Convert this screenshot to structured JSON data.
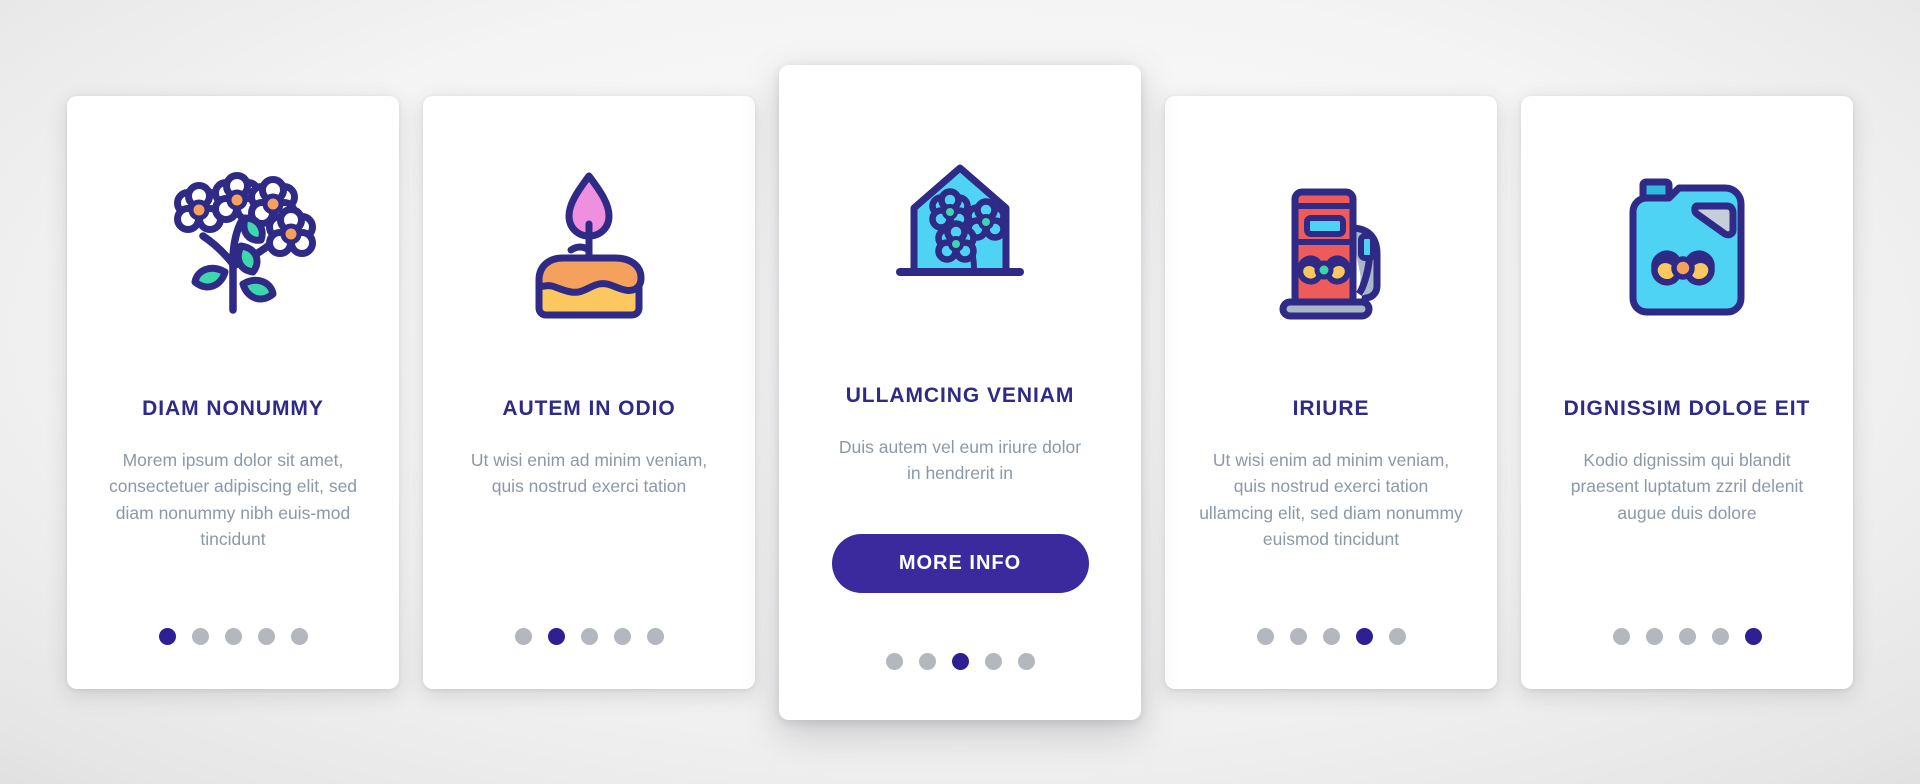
{
  "theme": {
    "navy": "#2e2a86",
    "deep_indigo": "#3b2a9e",
    "cyan": "#4fd3f5",
    "coral": "#ef5a5a",
    "orange": "#f5a15e",
    "yellow": "#fcc75e",
    "teal": "#3ed6ad",
    "pink": "#ef8fe0",
    "gray_text": "#8d98a6",
    "dot_inactive": "#b4b7bd",
    "dot_active": "#2e1f93",
    "card_bg": "#ffffff",
    "page_bg": "#d8d8d8"
  },
  "cards": [
    {
      "icon": "flower-branch-icon",
      "title": "DIAM NONUMMY",
      "body": "Morem ipsum dolor sit amet, consectetuer adipiscing elit, sed diam nonummy nibh euis-mod tincidunt",
      "dots": {
        "count": 5,
        "active": 0
      },
      "featured": false,
      "button": null
    },
    {
      "icon": "birthday-cake-candle-icon",
      "title": "AUTEM IN ODIO",
      "body": "Ut wisi enim ad minim veniam, quis nostrud exerci tation",
      "dots": {
        "count": 5,
        "active": 1
      },
      "featured": false,
      "button": null
    },
    {
      "icon": "greenhouse-icon",
      "title": "ULLAMCING VENIAM",
      "body": "Duis autem vel eum iriure dolor in hendrerit in",
      "dots": {
        "count": 5,
        "active": 2
      },
      "featured": true,
      "button": {
        "label": "MORE INFO"
      }
    },
    {
      "icon": "fuel-pump-icon",
      "title": "IRIURE",
      "body": "Ut wisi enim ad minim veniam, quis nostrud exerci tation ullamcing elit, sed diam nonummy euismod tincidunt",
      "dots": {
        "count": 5,
        "active": 3
      },
      "featured": false,
      "button": null
    },
    {
      "icon": "jerrycan-icon",
      "title": "DIGNISSIM DOLOE EIT",
      "body": "Kodio dignissim qui blandit praesent luptatum zzril delenit augue duis dolore",
      "dots": {
        "count": 5,
        "active": 4
      },
      "featured": false,
      "button": null
    }
  ]
}
